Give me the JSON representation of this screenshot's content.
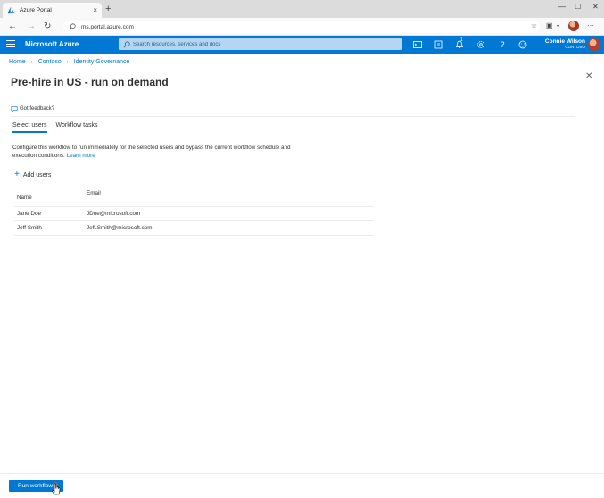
{
  "browser": {
    "tab_title": "Azure Portal",
    "url": "ms.portal.azure.com"
  },
  "azure": {
    "brand": "Microsoft Azure",
    "search_placeholder": "Search resources, services and docs",
    "notification_count": "1",
    "user_name": "Connie Wilson",
    "user_tenant": "CONTOSO"
  },
  "breadcrumb": [
    "Home",
    "Contoso",
    "Identity Governance"
  ],
  "page": {
    "title": "Pre-hire in US - run on demand",
    "feedback": "Got feedback?",
    "tabs": [
      {
        "label": "Select users",
        "active": true
      },
      {
        "label": "Workflow tasks",
        "active": false
      }
    ],
    "description": "Configure this workflow to run immediately for the selected users and bypass the current workflow schedule and execution conditions.",
    "learn_more": "Learn more",
    "add_users": "Add users"
  },
  "users_table": {
    "columns": [
      "Name",
      "Email"
    ],
    "rows": [
      {
        "name": "Jane Doe",
        "email": "JDoe@microsoft.com"
      },
      {
        "name": "Jeff Smith",
        "email": "Jeff.Smith@microsoft.com"
      }
    ]
  },
  "footer": {
    "run_label": "Run workflow"
  },
  "colors": {
    "azure_blue": "#0078d4",
    "search_bg": "#b4d6f1"
  }
}
